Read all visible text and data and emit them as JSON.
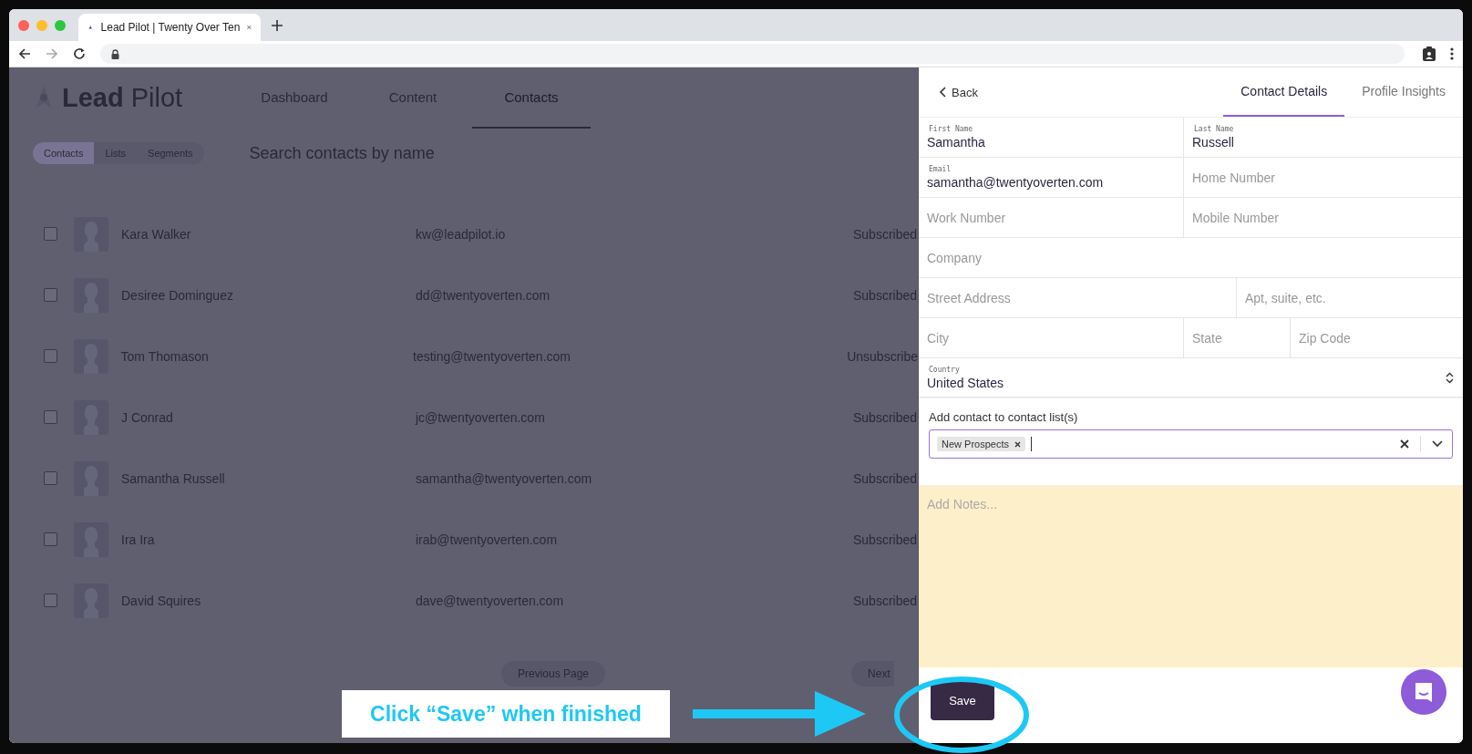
{
  "browser": {
    "tab_title": "Lead Pilot | Twenty Over Ten"
  },
  "app": {
    "logo": {
      "bold": "Lead",
      "light": "Pilot"
    },
    "nav": [
      {
        "label": "Dashboard",
        "selected": false
      },
      {
        "label": "Content",
        "selected": false
      },
      {
        "label": "Contacts",
        "selected": true
      }
    ],
    "view_switch": [
      {
        "label": "Contacts",
        "selected": true
      },
      {
        "label": "Lists",
        "selected": false
      },
      {
        "label": "Segments",
        "selected": false
      }
    ],
    "search": {
      "placeholder": "Search contacts by name"
    },
    "contacts": [
      {
        "name": "Kara Walker",
        "email": "kw@leadpilot.io",
        "status": "Subscribed",
        "checked": false
      },
      {
        "name": "Desiree Dominguez",
        "email": "dd@twentyoverten.com",
        "status": "Subscribed",
        "checked": false
      },
      {
        "name": "Tom Thomason",
        "email": "testing@twentyoverten.com",
        "status": "Unsubscribe",
        "checked": false
      },
      {
        "name": "J Conrad",
        "email": "jc@twentyoverten.com",
        "status": "Subscribed",
        "checked": false
      },
      {
        "name": "Samantha Russell",
        "email": "samantha@twentyoverten.com",
        "status": "Subscribed",
        "checked": false
      },
      {
        "name": "Ira Ira",
        "email": "irab@twentyoverten.com",
        "status": "Subscribed",
        "checked": false
      },
      {
        "name": "David Squires",
        "email": "dave@twentyoverten.com",
        "status": "Subscribed",
        "checked": false
      }
    ],
    "pagination": {
      "previous": "Previous Page",
      "next": "Next"
    }
  },
  "panel": {
    "back": "Back",
    "tabs": [
      {
        "label": "Contact Details",
        "selected": true
      },
      {
        "label": "Profile Insights",
        "selected": false
      }
    ],
    "form_rows": [
      [
        {
          "kind": "text",
          "label": "First Name",
          "value": "Samantha"
        },
        {
          "kind": "text",
          "label": "Last Name",
          "value": "Russell"
        }
      ],
      [
        {
          "kind": "text",
          "label": "Email",
          "value": "samantha@twentyoverten.com"
        },
        {
          "kind": "text",
          "placeholder": "Home Number"
        }
      ],
      [
        {
          "kind": "text",
          "placeholder": "Work Number"
        },
        {
          "kind": "text",
          "placeholder": "Mobile Number"
        }
      ],
      [
        {
          "kind": "text",
          "placeholder": "Company"
        }
      ],
      [
        {
          "kind": "text",
          "placeholder": "Street Address"
        },
        {
          "kind": "text",
          "placeholder": "Apt, suite, etc."
        }
      ],
      [
        {
          "kind": "text",
          "placeholder": "City"
        },
        {
          "kind": "text",
          "placeholder": "State"
        },
        {
          "kind": "text",
          "placeholder": "Zip Code"
        }
      ],
      [
        {
          "kind": "select",
          "label": "Country",
          "value": "United States"
        }
      ]
    ],
    "lists": {
      "label": "Add contact to contact list(s)",
      "tags": [
        {
          "label": "New Prospects"
        }
      ]
    },
    "notes": {
      "placeholder": "Add Notes..."
    },
    "save": "Save"
  },
  "annotation": {
    "text": "Click “Save” when finished"
  }
}
